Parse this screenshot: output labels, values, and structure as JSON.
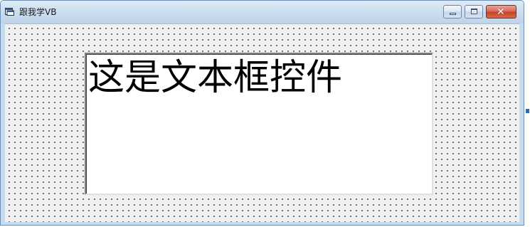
{
  "window": {
    "title": "跟我学VB"
  },
  "form": {
    "textbox": {
      "text": "这是文本框控件"
    }
  },
  "colors": {
    "titlebar": "#cddff1",
    "form_background": "#f0f0f0",
    "grid_dot": "#000000",
    "close_button": "#c1412a",
    "selection_handle": "#1f6fc1"
  },
  "icons": {
    "app": "form-window-icon",
    "minimize": "minimize-icon",
    "maximize": "maximize-icon",
    "close": "close-icon"
  }
}
